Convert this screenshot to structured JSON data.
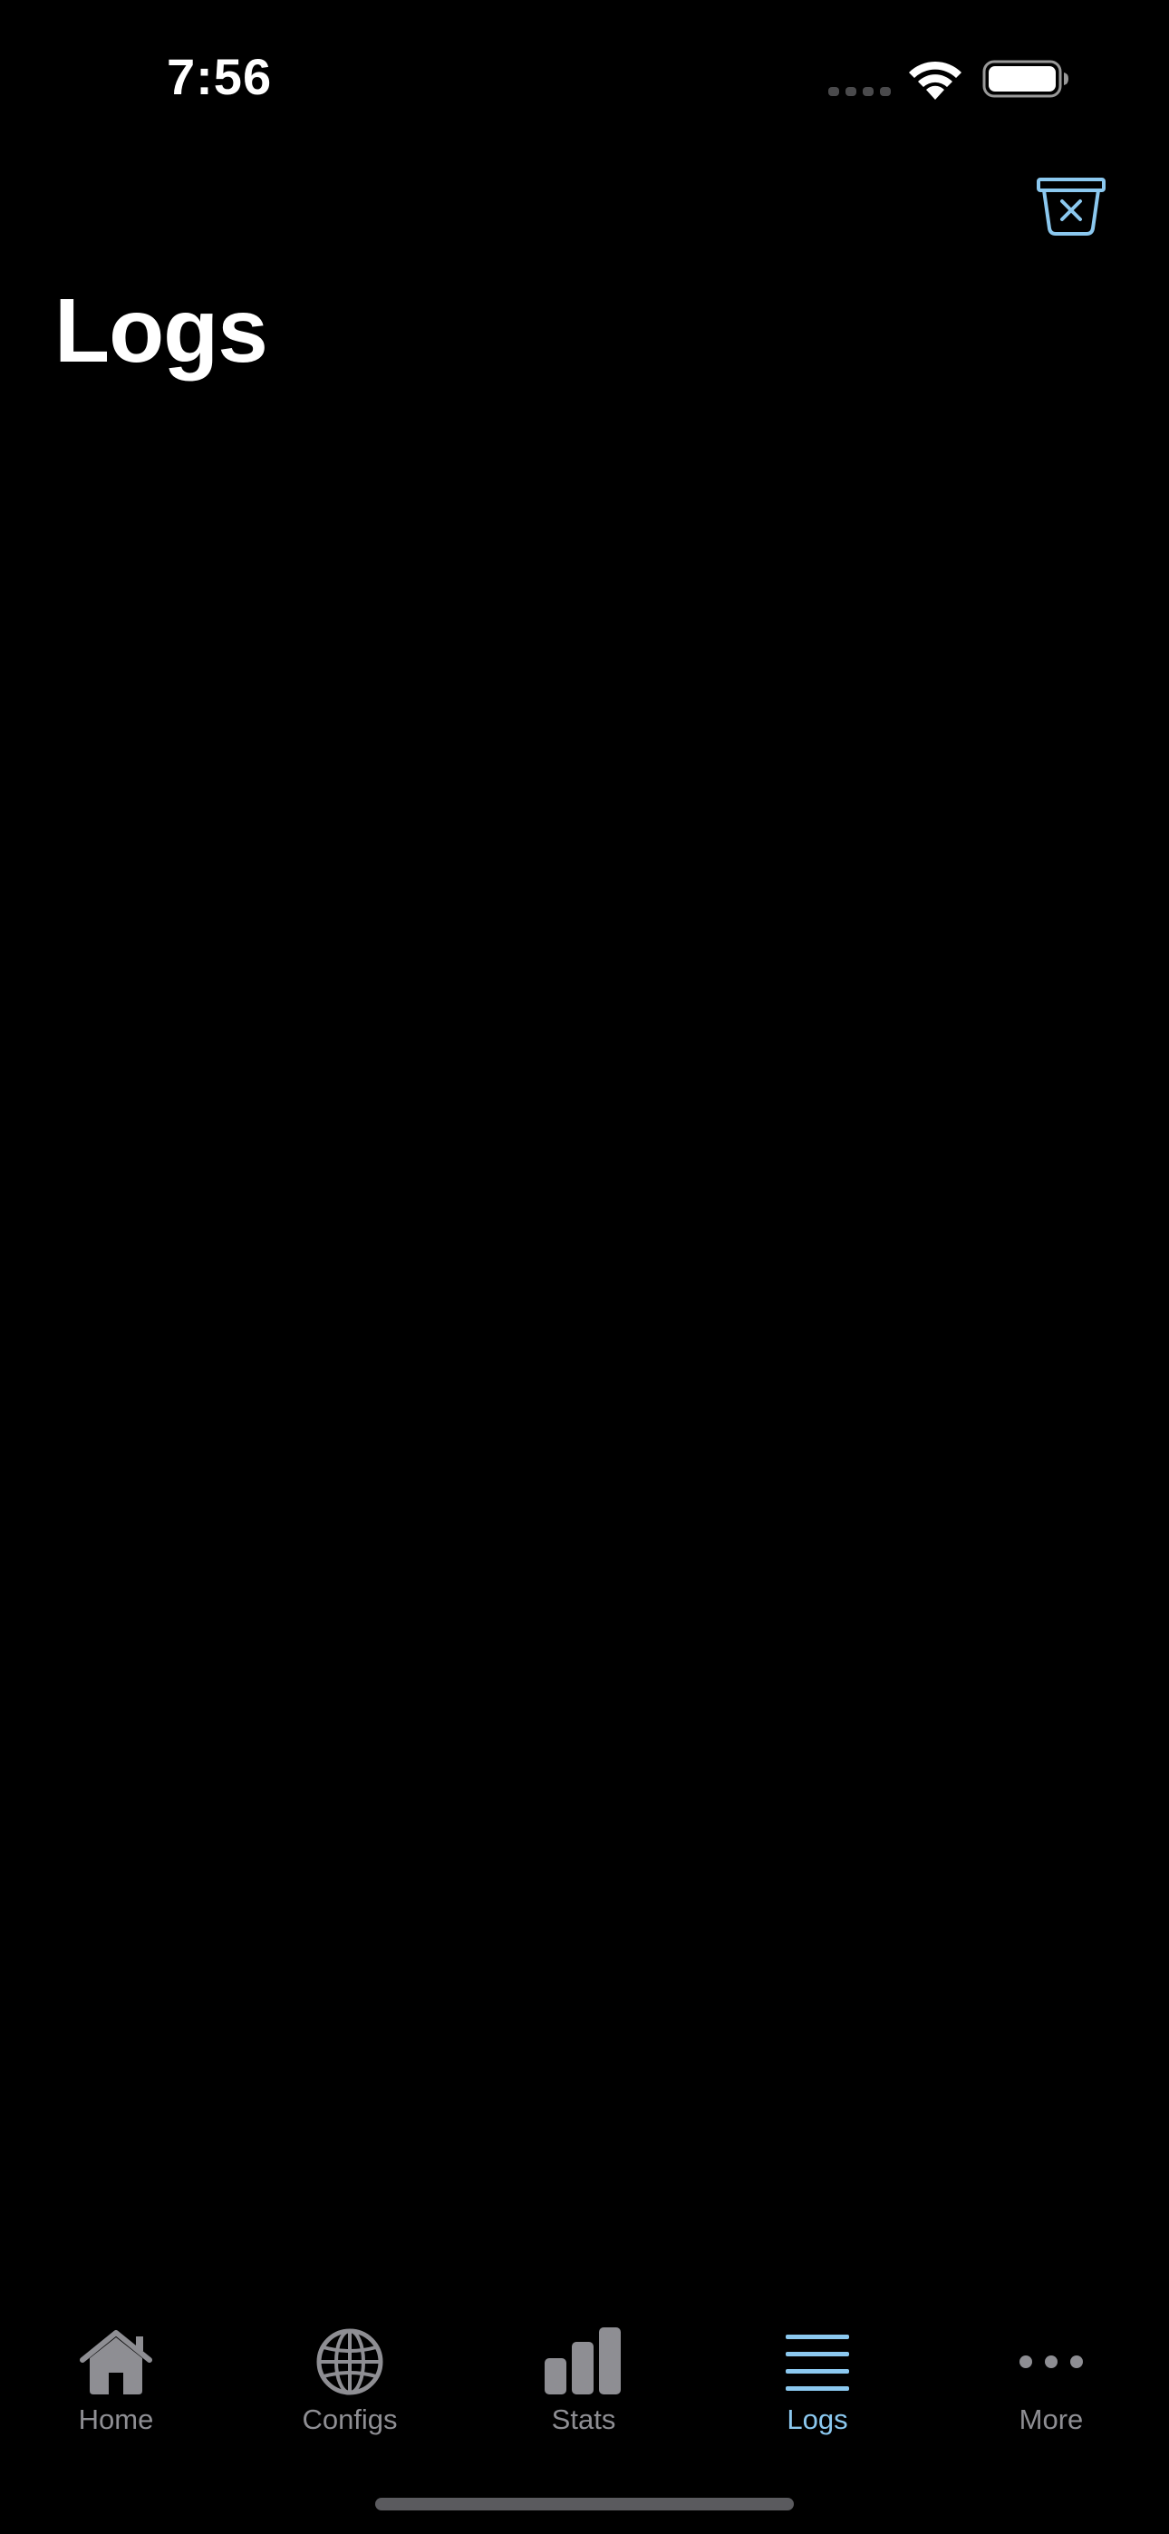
{
  "status_bar": {
    "time": "7:56"
  },
  "header": {
    "title": "Logs",
    "clear_icon": "trash-bin-x-icon"
  },
  "colors": {
    "background": "#000000",
    "accent": "#8bc8ef",
    "inactive": "#8e8e93"
  },
  "tab_bar": {
    "tabs": [
      {
        "label": "Home",
        "icon": "house-icon"
      },
      {
        "label": "Configs",
        "icon": "globe-icon"
      },
      {
        "label": "Stats",
        "icon": "bar-chart-icon"
      },
      {
        "label": "Logs",
        "icon": "list-lines-icon"
      },
      {
        "label": "More",
        "icon": "ellipsis-icon"
      }
    ],
    "active": "Logs"
  }
}
